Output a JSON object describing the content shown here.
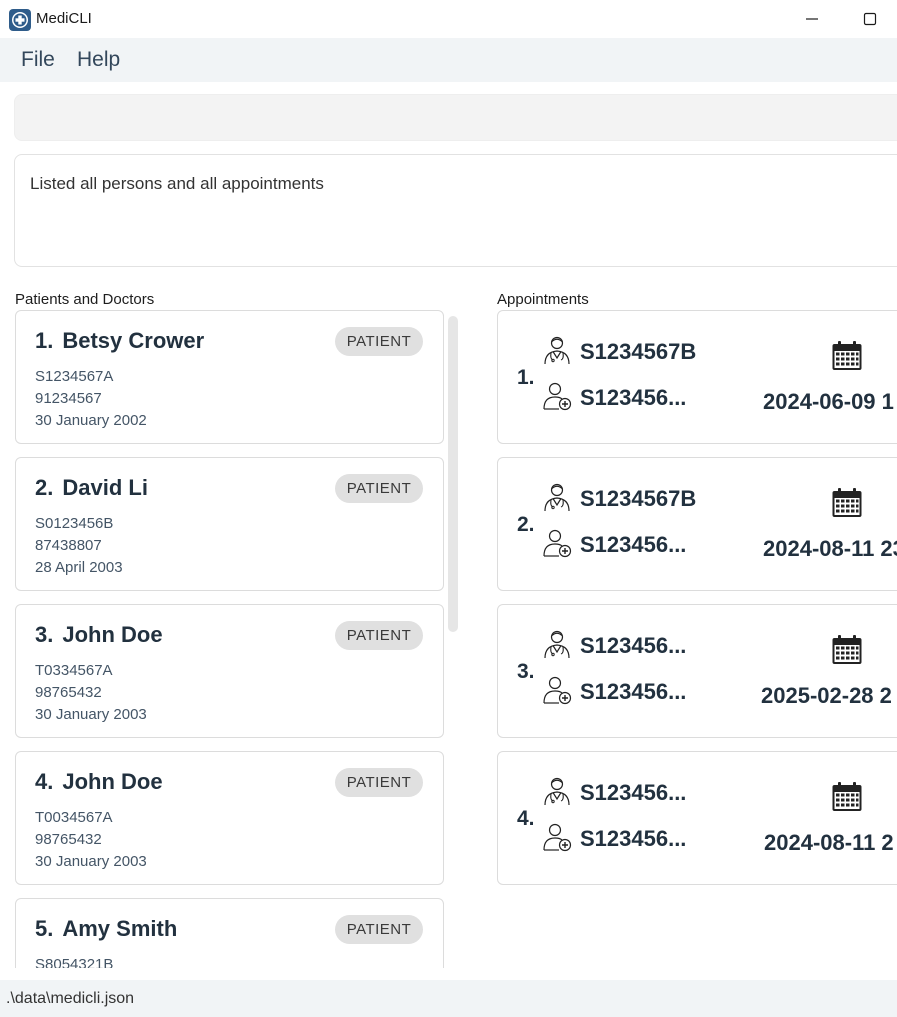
{
  "window": {
    "title": "MediCLI"
  },
  "menu": {
    "file": "File",
    "help": "Help"
  },
  "command": {
    "value": ""
  },
  "result": {
    "text": "Listed all persons and all appointments"
  },
  "persons_panel": {
    "title": "Patients and Doctors",
    "items": [
      {
        "index": "1.",
        "name": "Betsy Crower",
        "type": "PATIENT",
        "nric": "S1234567A",
        "phone": "91234567",
        "dob": "30 January 2002"
      },
      {
        "index": "2.",
        "name": "David Li",
        "type": "PATIENT",
        "nric": "S0123456B",
        "phone": "87438807",
        "dob": "28 April 2003"
      },
      {
        "index": "3.",
        "name": "John Doe",
        "type": "PATIENT",
        "nric": "T0334567A",
        "phone": "98765432",
        "dob": "30 January 2003"
      },
      {
        "index": "4.",
        "name": "John Doe",
        "type": "PATIENT",
        "nric": "T0034567A",
        "phone": "98765432",
        "dob": "30 January 2003"
      },
      {
        "index": "5.",
        "name": "Amy Smith",
        "type": "PATIENT",
        "nric": "S8054321B"
      }
    ]
  },
  "appointments_panel": {
    "title": "Appointments",
    "items": [
      {
        "index": "1.",
        "doctor_nric": "S1234567B",
        "patient_nric": "S123456...",
        "datetime": "2024-06-09 1"
      },
      {
        "index": "2.",
        "doctor_nric": "S1234567B",
        "patient_nric": "S123456...",
        "datetime": "2024-08-11 23"
      },
      {
        "index": "3.",
        "doctor_nric": "S123456...",
        "patient_nric": "S123456...",
        "datetime": "2025-02-28 2"
      },
      {
        "index": "4.",
        "doctor_nric": "S123456...",
        "patient_nric": "S123456...",
        "datetime": "2024-08-11 2"
      }
    ]
  },
  "status": {
    "path": ".\\data\\medicli.json"
  },
  "icons": {
    "app": "medical-cross-icon",
    "doctor": "doctor-icon",
    "patient": "patient-icon",
    "calendar": "calendar-icon"
  },
  "colors": {
    "accent": "#22313f",
    "badge": "#e0e0e0",
    "menubar": "#f1f4f6"
  }
}
